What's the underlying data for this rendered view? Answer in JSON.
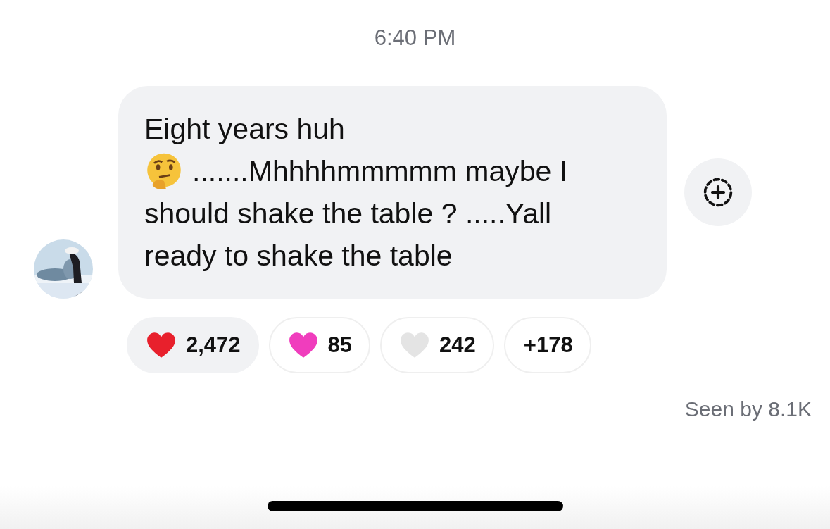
{
  "timestamp": "6:40 PM",
  "message": {
    "text_before": "Eight years huh",
    "text_after": ".......Mhhhhmmmmm maybe I",
    "text_rest": "should shake the table ? .....Yall ready to shake the table"
  },
  "reactions": [
    {
      "kind": "heart",
      "color": "#e8202c",
      "count": "2,472",
      "selected": true
    },
    {
      "kind": "heart",
      "color": "#f03dbd",
      "count": "85",
      "selected": false
    },
    {
      "kind": "heart",
      "color": "#e4e4e4",
      "count": "242",
      "selected": false
    },
    {
      "kind": "more",
      "count": "+178",
      "selected": false
    }
  ],
  "seen": "Seen by 8.1K"
}
